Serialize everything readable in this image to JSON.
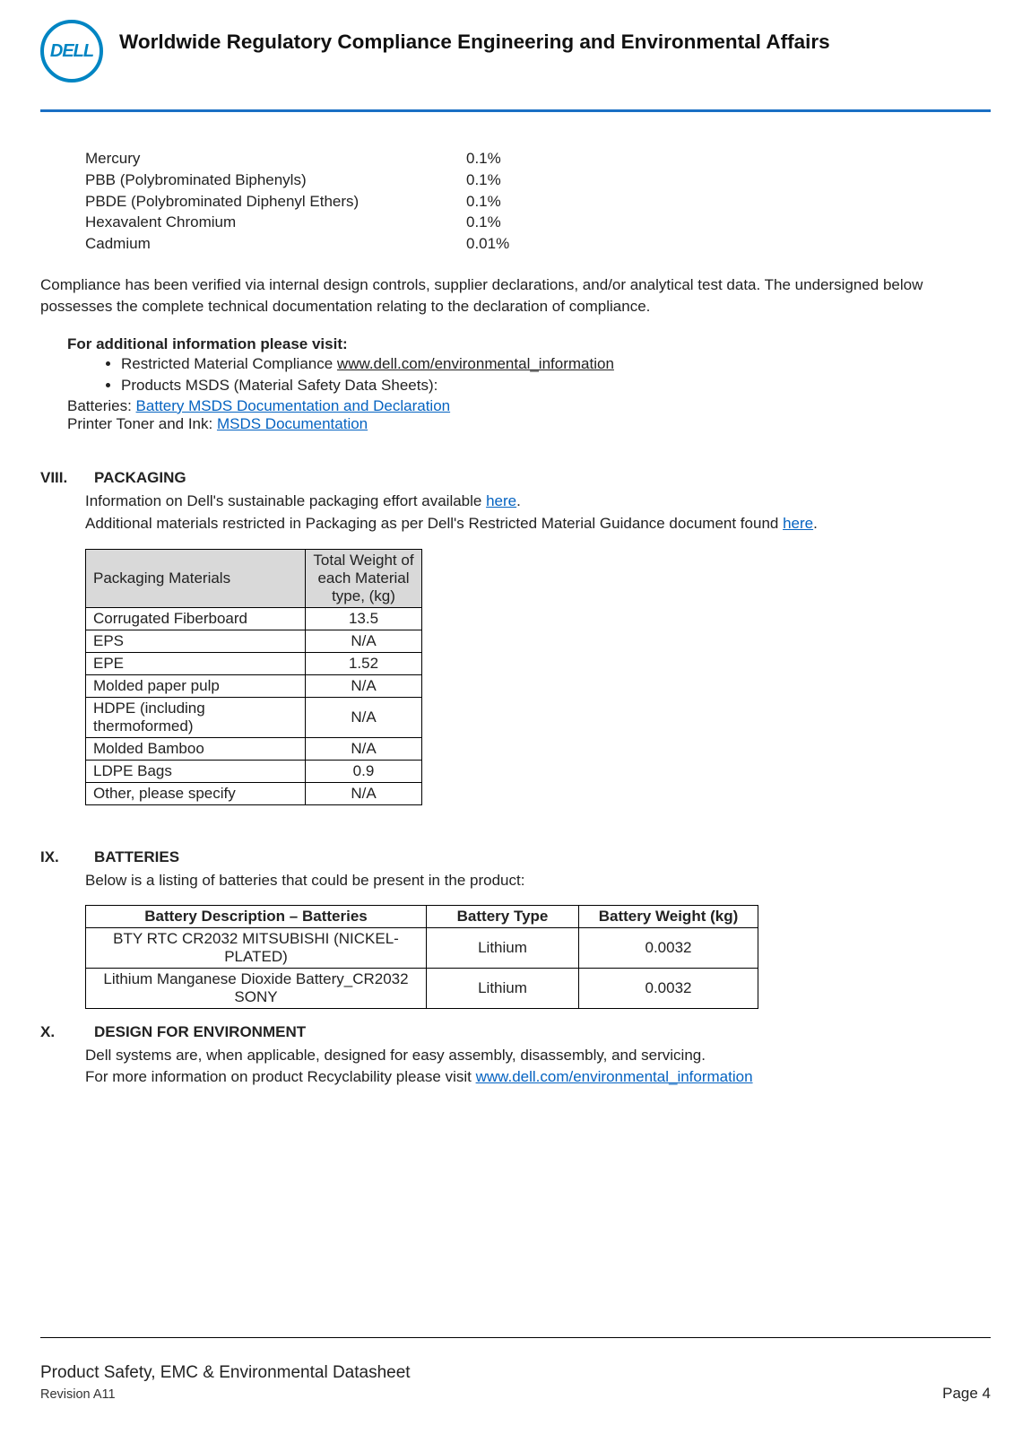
{
  "header": {
    "logo_text": "DELL",
    "title": "Worldwide Regulatory Compliance Engineering and Environmental Affairs"
  },
  "substances": [
    {
      "name": "Mercury",
      "value": "0.1%"
    },
    {
      "name": "PBB (Polybrominated Biphenyls)",
      "value": "0.1%"
    },
    {
      "name": "PBDE (Polybrominated Diphenyl Ethers)",
      "value": "0.1%"
    },
    {
      "name": "Hexavalent Chromium",
      "value": "0.1%"
    },
    {
      "name": "Cadmium",
      "value": "0.01%"
    }
  ],
  "compliance_para": "Compliance has been verified via internal design controls, supplier declarations, and/or analytical test data. The undersigned below possesses the complete technical documentation relating to the declaration of compliance.",
  "info_heading": "For additional information please visit:",
  "info_bullets": {
    "b1_pre": "Restricted Material Compliance ",
    "b1_link": "www.dell.com/environmental_information",
    "b2": "Products MSDS (Material Safety Data Sheets):"
  },
  "batteries_line": {
    "pre": "Batteries: ",
    "link": "Battery MSDS Documentation and Declaration"
  },
  "toner_line": {
    "pre": "Printer Toner and Ink:   ",
    "link": "MSDS Documentation"
  },
  "s8": {
    "num": "VIII.",
    "title": "PACKAGING",
    "line1_pre": "Information on Dell's sustainable packaging effort available ",
    "line1_link": "here",
    "line1_post": ".",
    "line2_pre": "Additional materials restricted in Packaging as per Dell's Restricted Material Guidance document found ",
    "line2_link": "here",
    "line2_post": "."
  },
  "pkg_table": {
    "h1": "Packaging Materials",
    "h2": "Total Weight of each Material type, (kg)",
    "rows": [
      {
        "mat": "Corrugated Fiberboard",
        "wt": "13.5"
      },
      {
        "mat": "EPS",
        "wt": "N/A"
      },
      {
        "mat": "EPE",
        "wt": "1.52"
      },
      {
        "mat": "Molded paper pulp",
        "wt": "N/A"
      },
      {
        "mat": "HDPE (including thermoformed)",
        "wt": "N/A"
      },
      {
        "mat": "Molded Bamboo",
        "wt": "N/A"
      },
      {
        "mat": "LDPE Bags",
        "wt": "0.9"
      },
      {
        "mat": "Other, please specify",
        "wt": "N/A"
      }
    ]
  },
  "s9": {
    "num": "IX.",
    "title": "BATTERIES",
    "intro": "Below is a listing of batteries that could be present in the product:"
  },
  "bat_table": {
    "h1": "Battery Description – Batteries",
    "h2": "Battery Type",
    "h3": "Battery Weight (kg)",
    "rows": [
      {
        "desc": "BTY RTC CR2032 MITSUBISHI (NICKEL-PLATED)",
        "type": "Lithium",
        "wt": "0.0032"
      },
      {
        "desc": "Lithium Manganese Dioxide Battery_CR2032 SONY",
        "type": "Lithium",
        "wt": "0.0032"
      }
    ]
  },
  "s10": {
    "num": "X.",
    "title": "DESIGN FOR ENVIRONMENT",
    "line1": "Dell systems are, when applicable, designed for easy assembly, disassembly, and servicing.",
    "line2_pre": "For more information on product Recyclability please visit ",
    "line2_link": "www.dell.com/environmental_information"
  },
  "footer": {
    "line1": "Product Safety, EMC & Environmental Datasheet",
    "revision": "Revision A11",
    "page": "Page 4"
  }
}
